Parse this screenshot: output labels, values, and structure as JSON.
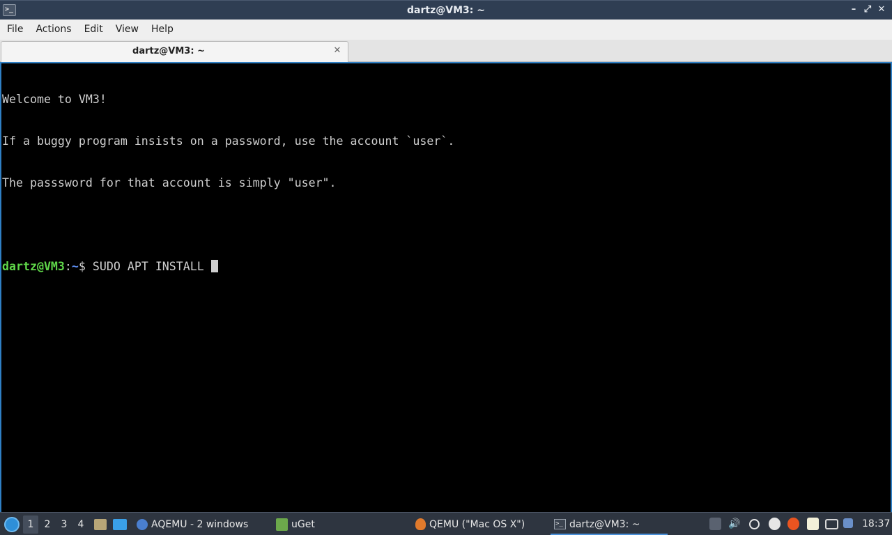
{
  "window": {
    "title": "dartz@VM3: ~",
    "app_icon_glyph": ">_",
    "controls": {
      "minimize": "–",
      "maximize": "⤢",
      "close": "✕"
    }
  },
  "menu": {
    "items": [
      "File",
      "Actions",
      "Edit",
      "View",
      "Help"
    ]
  },
  "tabs": [
    {
      "label": "dartz@VM3: ~",
      "close_glyph": "✕"
    }
  ],
  "terminal": {
    "lines": [
      "Welcome to VM3!",
      "If a buggy program insists on a password, use the account `user`.",
      "The passsword for that account is simply \"user\"."
    ],
    "prompt": {
      "user_host": "dartz@VM3",
      "colon": ":",
      "path": "~",
      "symbol": "$ ",
      "command": "SUDO APT INSTALL "
    },
    "colors": {
      "background": "#000000",
      "foreground": "#cfcfcf",
      "prompt_user": "#5fd749",
      "prompt_path": "#5d8df0",
      "focus_border": "#2f7fc4"
    }
  },
  "taskbar": {
    "workspaces": [
      "1",
      "2",
      "3",
      "4"
    ],
    "active_workspace": "1",
    "tasks": [
      {
        "label": "AQEMU - 2 windows",
        "icon": "aqemu-icon"
      },
      {
        "label": "uGet",
        "icon": "uget-icon"
      },
      {
        "label": "QEMU (\"Mac OS X\")",
        "icon": "qemu-icon"
      },
      {
        "label": "dartz@VM3: ~",
        "icon": "terminal-icon",
        "active": true
      }
    ],
    "tray_icons": [
      "scroll-up-icon",
      "volume-icon",
      "clipboard-icon",
      "update-icon",
      "ubuntu-icon",
      "notes-icon",
      "network-icon",
      "notification-icon"
    ],
    "clock": "18:37"
  }
}
